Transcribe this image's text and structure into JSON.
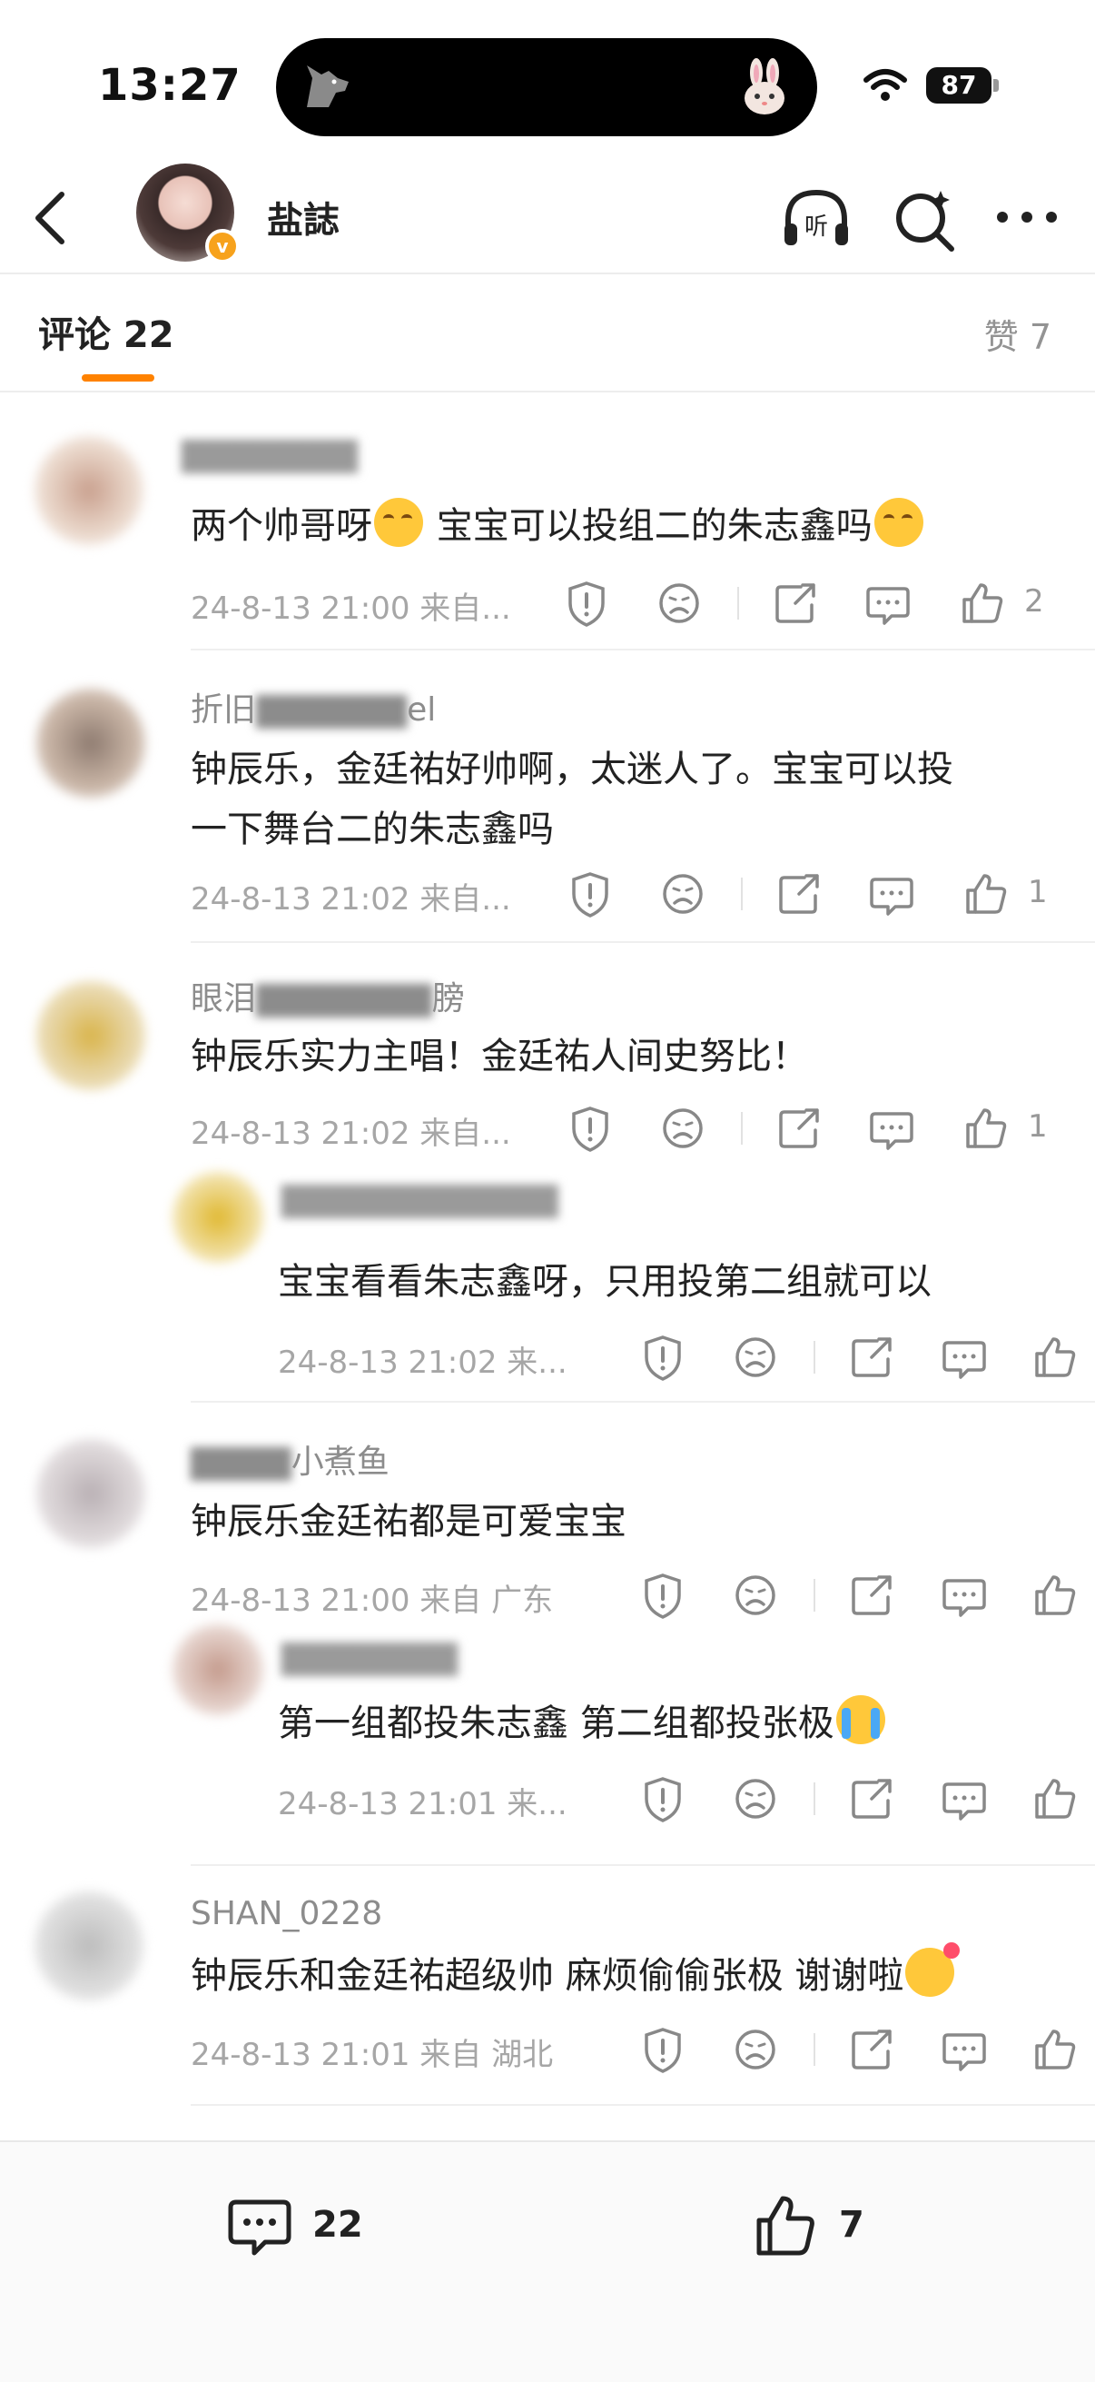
{
  "status_bar": {
    "time": "13:27",
    "battery": "87"
  },
  "header": {
    "title": "盐誌"
  },
  "tabs": {
    "comments_label": "评论 22",
    "likes_label": "赞 7"
  },
  "comments": [
    {
      "name": "",
      "text_pre": "两个帅哥呀",
      "text_mid": " 宝宝可以投组二的朱志鑫吗",
      "meta": "24-8-13 21:00 来自...",
      "likes": "2"
    },
    {
      "name": "折旧",
      "name_tail": "el",
      "text_line1": "钟辰乐，金廷祐好帅啊，太迷人了。宝宝可以投",
      "text_line2": "一下舞台二的朱志鑫吗",
      "meta": "24-8-13 21:02 来自...",
      "likes": "1"
    },
    {
      "name": "眼泪",
      "name_tail": "膀",
      "text": "钟辰乐实力主唱！金廷祐人间史努比！",
      "meta": "24-8-13 21:02 来自...",
      "likes": "1"
    },
    {
      "name": "",
      "text": "宝宝看看朱志鑫呀，只用投第二组就可以",
      "meta": "24-8-13 21:02 来..."
    },
    {
      "name": "",
      "name_tail": "小煮鱼",
      "text": "钟辰乐金廷祐都是可爱宝宝",
      "meta": "24-8-13 21:00 来自 广东"
    },
    {
      "name": "",
      "text": "第一组都投朱志鑫 第二组都投张极",
      "meta": "24-8-13 21:01 来..."
    },
    {
      "name": "SHAN_0228",
      "text": "钟辰乐和金廷祐超级帅  麻烦偷偷张极  谢谢啦",
      "meta": "24-8-13 21:01 来自 湖北"
    }
  ],
  "bottom_bar": {
    "comment_count": "22",
    "like_count": "7"
  }
}
